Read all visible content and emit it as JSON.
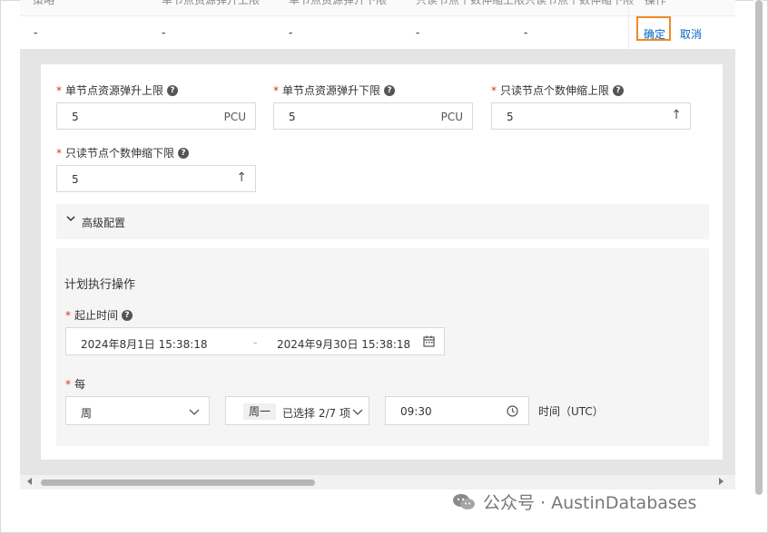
{
  "table": {
    "header_cells": [
      "策略",
      "单节点资源弹升上限",
      "单节点资源弹升下限",
      "只读节点个数伸缩上限",
      "只读节点个数伸缩下限",
      "操作"
    ],
    "row_values": [
      "-",
      "-",
      "-",
      "-",
      "-"
    ],
    "actions": {
      "confirm": "确定",
      "cancel": "取消"
    }
  },
  "form": {
    "field1": {
      "label": "单节点资源弹升上限",
      "value": "5",
      "suffix": "PCU"
    },
    "field2": {
      "label": "单节点资源弹升下限",
      "value": "5",
      "suffix": "PCU"
    },
    "field3": {
      "label": "只读节点个数伸缩上限",
      "value": "5",
      "suffix": "↑"
    },
    "field4": {
      "label": "只读节点个数伸缩下限",
      "value": "5",
      "suffix": "↑"
    },
    "required_mark": "*",
    "advanced": {
      "label": "高级配置"
    },
    "schedule": {
      "title": "计划执行操作",
      "time_range_label": "起止时间",
      "start": "2024年8月1日 15:38:18",
      "separator": "-",
      "end": "2024年9月30日 15:38:18",
      "every_label": "每",
      "period": "周",
      "day_tag": "周一",
      "day_summary": "已选择 2/7 项",
      "time": "09:30",
      "time_suffix": "时间（UTC）"
    }
  },
  "watermark": {
    "text": "公众号 · AustinDatabases"
  },
  "colors": {
    "highlight": "#f08a24",
    "link": "#0064c8",
    "required": "#d93026"
  }
}
